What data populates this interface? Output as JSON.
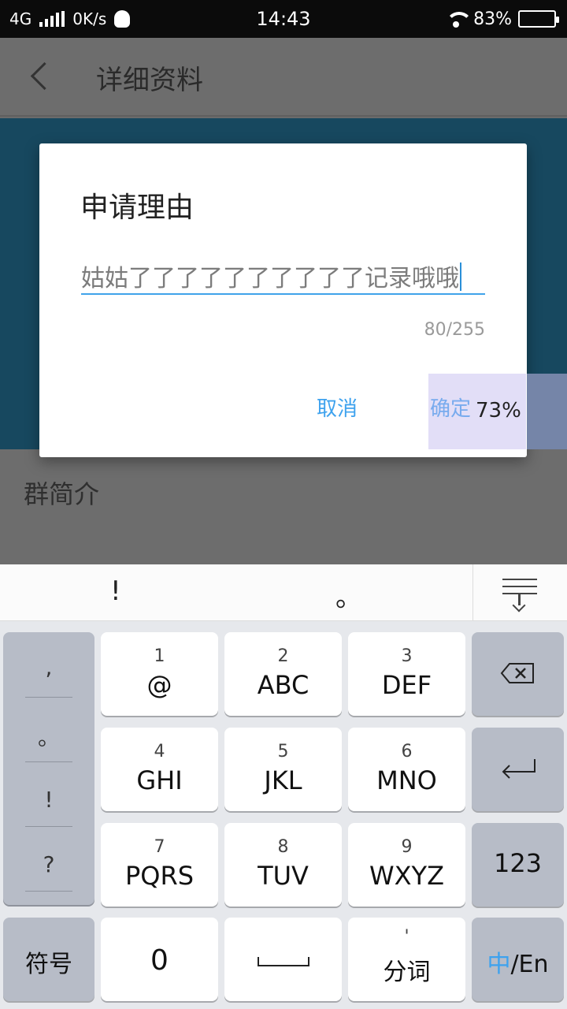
{
  "status_bar": {
    "network": "4G",
    "speed": "0K/s",
    "time": "14:43",
    "battery_percent": "83%",
    "battery_level": 0.83
  },
  "app_bar": {
    "title": "详细资料"
  },
  "background": {
    "intro_title": "群简介"
  },
  "dialog": {
    "title": "申请理由",
    "input_value": "姑姑了了了了了了了了了了记录哦哦",
    "counter": "80/255",
    "cancel_label": "取消",
    "confirm_label": "确定",
    "overlay_percent": "73%"
  },
  "keyboard": {
    "suggestions": [
      "!",
      "。"
    ],
    "punctuation": [
      ",",
      "。",
      "!",
      "?"
    ],
    "keys": [
      {
        "num": "1",
        "letters": "@"
      },
      {
        "num": "2",
        "letters": "ABC"
      },
      {
        "num": "3",
        "letters": "DEF"
      },
      {
        "num": "4",
        "letters": "GHI"
      },
      {
        "num": "5",
        "letters": "JKL"
      },
      {
        "num": "6",
        "letters": "MNO"
      },
      {
        "num": "7",
        "letters": "PQRS"
      },
      {
        "num": "8",
        "letters": "TUV"
      },
      {
        "num": "9",
        "letters": "WXYZ"
      }
    ],
    "numeric_key": "123",
    "symbols_key": "符号",
    "zero_key": "0",
    "segment_key_top": "'",
    "segment_key": "分词",
    "lang_key_cn": "中",
    "lang_key_en": "/En",
    "accent_color": "#3ea2ee"
  }
}
